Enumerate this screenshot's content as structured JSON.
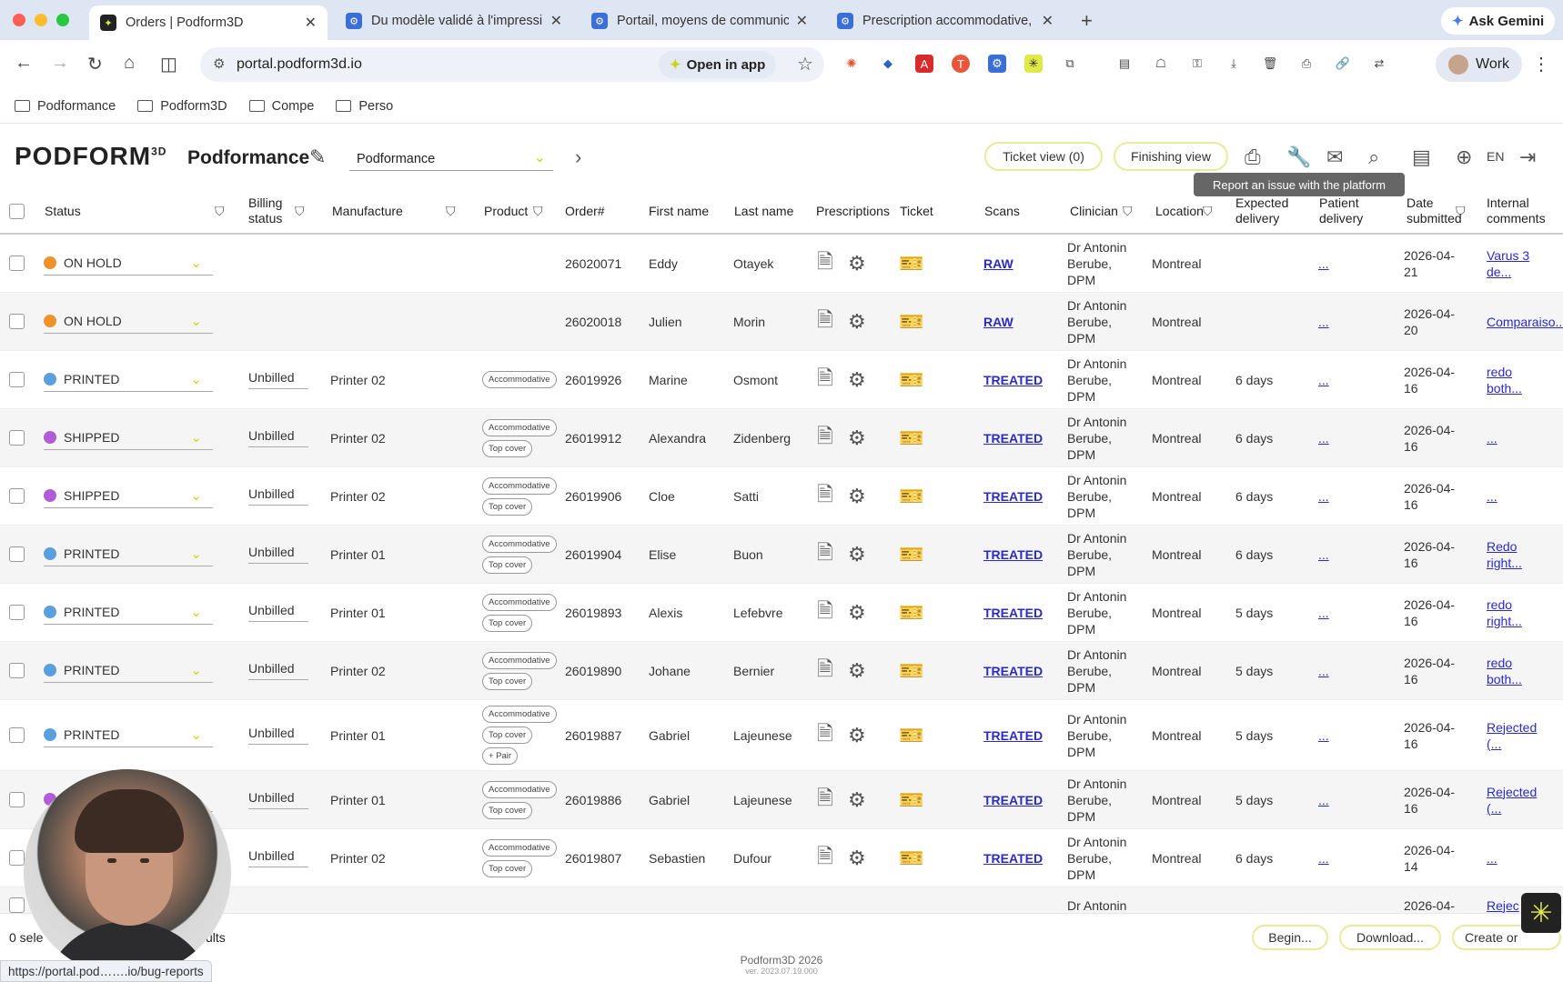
{
  "browser": {
    "tabs": [
      {
        "title": "Orders | Podform3D",
        "active": true
      },
      {
        "title": "Du modèle validé à l'impressi",
        "active": false
      },
      {
        "title": "Portail, moyens de communic",
        "active": false
      },
      {
        "title": "Prescription accommodative,",
        "active": false
      }
    ],
    "gemini_label": "Ask Gemini",
    "url": "portal.podform3d.io",
    "open_in_app": "Open in app",
    "profile": "Work",
    "bookmarks": [
      "Podformance",
      "Podform3D",
      "Compe",
      "Perso"
    ]
  },
  "app": {
    "logo": "PODFORM",
    "logo_sup": "3D",
    "company": "Podformance",
    "company_select": "Podformance",
    "ticket_view": "Ticket view (0)",
    "finishing_view": "Finishing view",
    "tooltip": "Report an issue with the platform",
    "lang": "EN"
  },
  "columns": {
    "status": "Status",
    "billing": "Billing status",
    "manufacture": "Manufacture",
    "product": "Product",
    "order": "Order#",
    "first": "First name",
    "last": "Last name",
    "prescriptions": "Prescriptions",
    "ticket": "Ticket",
    "scans": "Scans",
    "clinician": "Clinician",
    "location": "Location",
    "expected": "Expected delivery",
    "patient": "Patient delivery",
    "date": "Date submitted",
    "comments": "Internal comments"
  },
  "rows": [
    {
      "status": "ON HOLD",
      "color": "#f0922b",
      "billing": "",
      "manufacture": "",
      "tags": [],
      "order": "26020071",
      "first": "Eddy",
      "last": "Otayek",
      "scan": "RAW",
      "clinician": [
        "Dr Antonin",
        "Berube,",
        "DPM"
      ],
      "location": "Montreal",
      "expected": "",
      "patient": "...",
      "date": [
        "2026-04-",
        "21"
      ],
      "comment": [
        "Varus 3",
        "de..."
      ]
    },
    {
      "status": "ON HOLD",
      "color": "#f0922b",
      "billing": "",
      "manufacture": "",
      "tags": [],
      "order": "26020018",
      "first": "Julien",
      "last": "Morin",
      "scan": "RAW",
      "clinician": [
        "Dr Antonin",
        "Berube,",
        "DPM"
      ],
      "location": "Montreal",
      "expected": "",
      "patient": "...",
      "date": [
        "2026-04-",
        "20"
      ],
      "comment": [
        "Comparaiso..."
      ]
    },
    {
      "status": "PRINTED",
      "color": "#5b9fdc",
      "billing": "Unbilled",
      "manufacture": "Printer 02",
      "tags": [
        "Accommodative"
      ],
      "order": "26019926",
      "first": "Marine",
      "last": "Osmont",
      "scan": "TREATED",
      "clinician": [
        "Dr Antonin",
        "Berube,",
        "DPM"
      ],
      "location": "Montreal",
      "expected": "6 days",
      "patient": "...",
      "date": [
        "2026-04-",
        "16"
      ],
      "comment": [
        "redo",
        "both..."
      ]
    },
    {
      "status": "SHIPPED",
      "color": "#b25bd6",
      "billing": "Unbilled",
      "manufacture": "Printer 02",
      "tags": [
        "Accommodative",
        "Top cover"
      ],
      "order": "26019912",
      "first": "Alexandra",
      "last": "Zidenberg",
      "scan": "TREATED",
      "clinician": [
        "Dr Antonin",
        "Berube,",
        "DPM"
      ],
      "location": "Montreal",
      "expected": "6 days",
      "patient": "...",
      "date": [
        "2026-04-",
        "16"
      ],
      "comment": [
        "..."
      ]
    },
    {
      "status": "SHIPPED",
      "color": "#b25bd6",
      "billing": "Unbilled",
      "manufacture": "Printer 02",
      "tags": [
        "Accommodative",
        "Top cover"
      ],
      "order": "26019906",
      "first": "Cloe",
      "last": "Satti",
      "scan": "TREATED",
      "clinician": [
        "Dr Antonin",
        "Berube,",
        "DPM"
      ],
      "location": "Montreal",
      "expected": "6 days",
      "patient": "...",
      "date": [
        "2026-04-",
        "16"
      ],
      "comment": [
        "..."
      ]
    },
    {
      "status": "PRINTED",
      "color": "#5b9fdc",
      "billing": "Unbilled",
      "manufacture": "Printer 01",
      "tags": [
        "Accommodative",
        "Top cover"
      ],
      "order": "26019904",
      "first": "Elise",
      "last": "Buon",
      "scan": "TREATED",
      "clinician": [
        "Dr Antonin",
        "Berube,",
        "DPM"
      ],
      "location": "Montreal",
      "expected": "6 days",
      "patient": "...",
      "date": [
        "2026-04-",
        "16"
      ],
      "comment": [
        "Redo",
        "right..."
      ]
    },
    {
      "status": "PRINTED",
      "color": "#5b9fdc",
      "billing": "Unbilled",
      "manufacture": "Printer 01",
      "tags": [
        "Accommodative",
        "Top cover"
      ],
      "order": "26019893",
      "first": "Alexis",
      "last": "Lefebvre",
      "scan": "TREATED",
      "clinician": [
        "Dr Antonin",
        "Berube,",
        "DPM"
      ],
      "location": "Montreal",
      "expected": "5 days",
      "patient": "...",
      "date": [
        "2026-04-",
        "16"
      ],
      "comment": [
        "redo",
        "right..."
      ]
    },
    {
      "status": "PRINTED",
      "color": "#5b9fdc",
      "billing": "Unbilled",
      "manufacture": "Printer 02",
      "tags": [
        "Accommodative",
        "Top cover"
      ],
      "order": "26019890",
      "first": "Johane",
      "last": "Bernier",
      "scan": "TREATED",
      "clinician": [
        "Dr Antonin",
        "Berube,",
        "DPM"
      ],
      "location": "Montreal",
      "expected": "5 days",
      "patient": "...",
      "date": [
        "2026-04-",
        "16"
      ],
      "comment": [
        "redo",
        "both..."
      ]
    },
    {
      "status": "PRINTED",
      "color": "#5b9fdc",
      "billing": "Unbilled",
      "manufacture": "Printer 01",
      "tags": [
        "Accommodative",
        "Top cover",
        "+ Pair"
      ],
      "order": "26019887",
      "first": "Gabriel",
      "last": "Lajeunese",
      "scan": "TREATED",
      "clinician": [
        "Dr Antonin",
        "Berube,",
        "DPM"
      ],
      "location": "Montreal",
      "expected": "5 days",
      "patient": "...",
      "date": [
        "2026-04-",
        "16"
      ],
      "comment": [
        "Rejected",
        "(..."
      ]
    },
    {
      "status": "",
      "color": "#b25bd6",
      "billing": "Unbilled",
      "manufacture": "Printer 01",
      "tags": [
        "Accommodative",
        "Top cover"
      ],
      "order": "26019886",
      "first": "Gabriel",
      "last": "Lajeunese",
      "scan": "TREATED",
      "clinician": [
        "Dr Antonin",
        "Berube,",
        "DPM"
      ],
      "location": "Montreal",
      "expected": "5 days",
      "patient": "...",
      "date": [
        "2026-04-",
        "16"
      ],
      "comment": [
        "Rejected",
        "(..."
      ]
    },
    {
      "status": "",
      "color": "#5b9fdc",
      "billing": "Unbilled",
      "manufacture": "Printer 02",
      "tags": [
        "Accommodative",
        "Top cover"
      ],
      "order": "26019807",
      "first": "Sebastien",
      "last": "Dufour",
      "scan": "TREATED",
      "clinician": [
        "Dr Antonin",
        "Berube,",
        "DPM"
      ],
      "location": "Montreal",
      "expected": "6 days",
      "patient": "...",
      "date": [
        "2026-04-",
        "14"
      ],
      "comment": [
        "..."
      ]
    },
    {
      "status": "",
      "color": "#5b9fdc",
      "billing": "",
      "manufacture": "",
      "tags": [],
      "order": "",
      "first": "",
      "last": "",
      "scan": "",
      "clinician": [
        "Dr Antonin"
      ],
      "location": "",
      "expected": "",
      "patient": "",
      "date": [
        "2026-04-"
      ],
      "comment": [
        "Rejec"
      ]
    }
  ],
  "footer": {
    "selected": "0 sele",
    "results": "ults",
    "begin": "Begin...",
    "download": "Download...",
    "create": "Create or",
    "copyright": "Podform3D 2026",
    "version": "ver. 2023.07.19.000"
  },
  "status_url": "https://portal.pod…….io/bug-reports"
}
